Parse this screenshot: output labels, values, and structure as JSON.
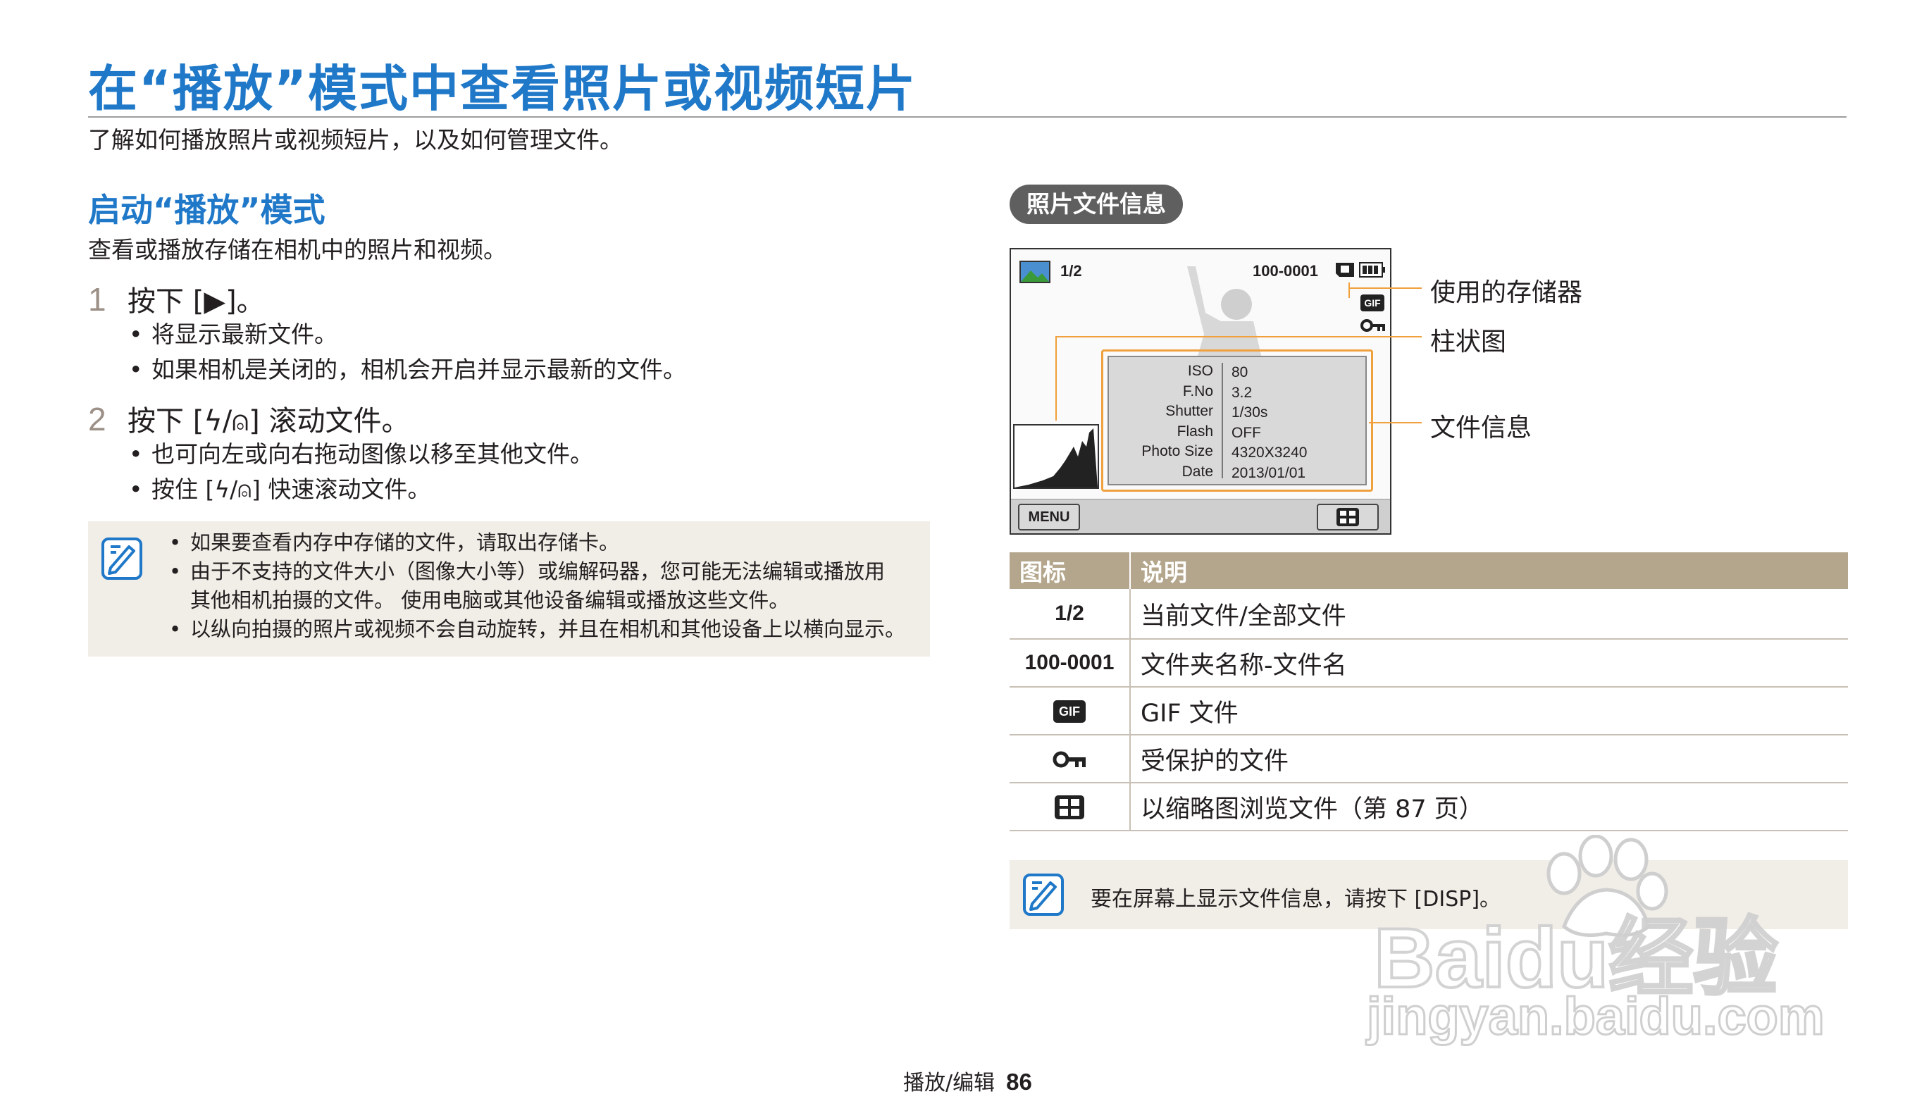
{
  "header": {
    "title": "在“播放”模式中查看照片或视频短片",
    "subtitle": "了解如何播放照片或视频短片，以及如何管理文件。"
  },
  "left": {
    "section_title": "启动“播放”模式",
    "section_desc": "查看或播放存储在相机中的照片和视频。",
    "steps": [
      {
        "num": "1",
        "text": "按下 [▶]。",
        "bullets": [
          "将显示最新文件。",
          "如果相机是关闭的，相机会开启并显示最新的文件。"
        ]
      },
      {
        "num": "2",
        "text": "按下 [ϟ/⍝] 滚动文件。",
        "bullets": [
          "也可向左或向右拖动图像以移至其他文件。",
          "按住 [ϟ/⍝] 快速滚动文件。"
        ]
      }
    ],
    "note": {
      "icon": "note-pencil-icon",
      "items": [
        "如果要查看内存中存储的文件，请取出存储卡。",
        "由于不支持的文件大小（图像大小等）或编解码器，您可能无法编辑或播放用\n其他相机拍摄的文件。 使用电脑或其他设备编辑或播放这些文件。",
        "以纵向拍摄的照片或视频不会自动旋转，并且在相机和其他设备上以横向显示。"
      ]
    }
  },
  "right": {
    "pill": "照片文件信息",
    "screen": {
      "count": "1/2",
      "file": "100-0001",
      "info_labels": [
        "ISO",
        "F.No",
        "Shutter",
        "Flash",
        "Photo Size",
        "Date"
      ],
      "info_values": [
        "80",
        "3.2",
        "1/30s",
        "OFF",
        "4320X3240",
        "2013/01/01"
      ],
      "menu": "MENU",
      "gif_badge": "GIF"
    },
    "callouts": {
      "storage": "使用的存储器",
      "histogram": "柱状图",
      "fileinfo": "文件信息"
    },
    "table": {
      "headers": [
        "图标",
        "说明"
      ],
      "rows": [
        {
          "icon": "1/2",
          "desc": "当前文件/全部文件"
        },
        {
          "icon": "100-0001",
          "desc": "文件夹名称-文件名"
        },
        {
          "icon": "gif-icon",
          "desc": "GIF 文件"
        },
        {
          "icon": "key-protect-icon",
          "desc": "受保护的文件"
        },
        {
          "icon": "thumbnail-grid-icon",
          "desc": "以缩略图浏览文件（第 87 页）"
        }
      ]
    },
    "note2": {
      "icon": "note-pencil-icon",
      "text": "要在屏幕上显示文件信息，请按下 [DISP]。"
    }
  },
  "footer": {
    "section": "播放/编辑",
    "page": "86"
  },
  "watermark": {
    "line1": "Baidu经验",
    "line2": "jingyan.baidu.com"
  },
  "colors": {
    "title_blue": "#1f78c8",
    "callout_orange": "#f0a03c",
    "table_header": "#b4a68c",
    "note_bg": "#f1ede7"
  }
}
